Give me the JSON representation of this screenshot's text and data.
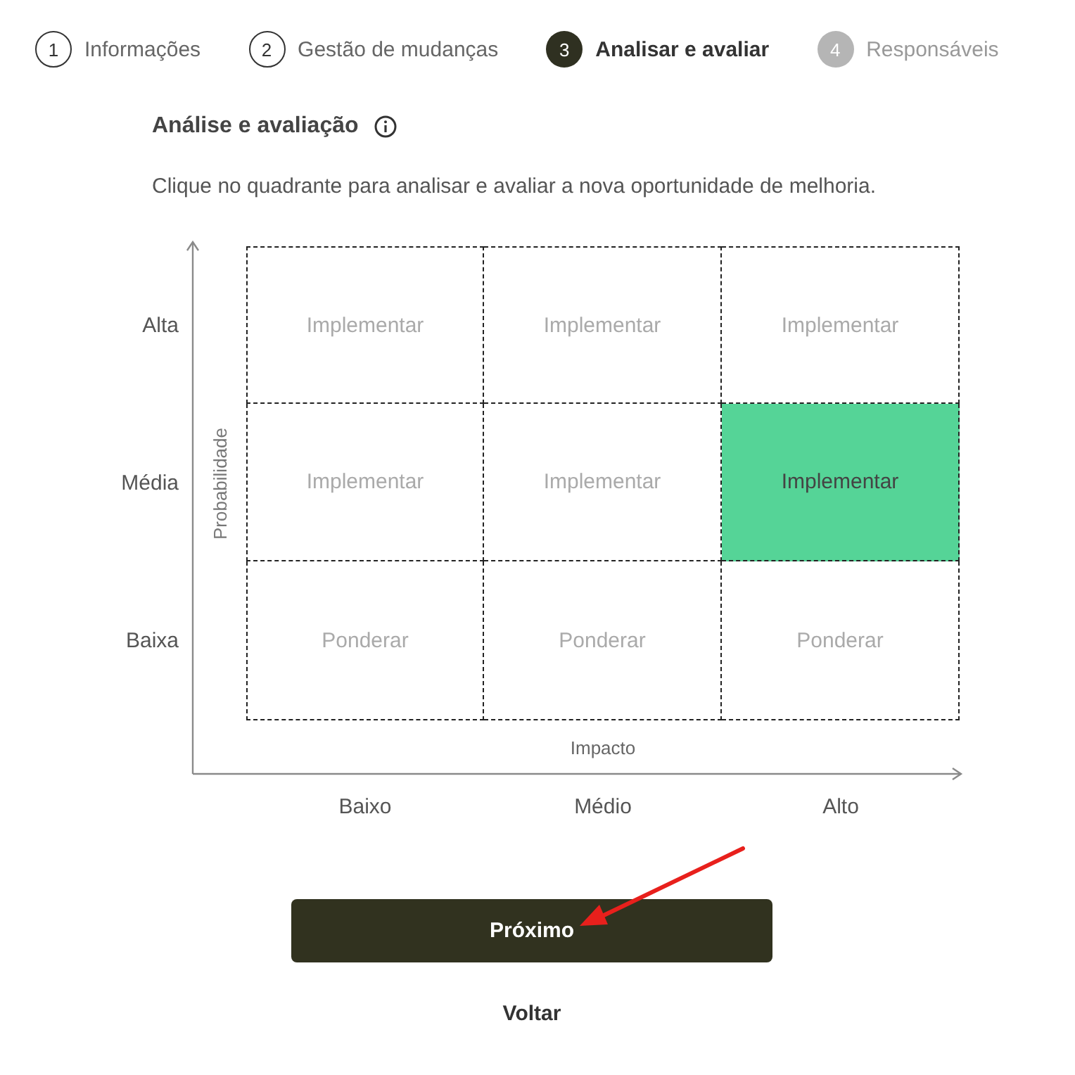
{
  "steps": [
    {
      "number": "1",
      "label": "Informações",
      "completed": true,
      "selected": false
    },
    {
      "number": "2",
      "label": "Gestão de mudanças",
      "completed": true,
      "selected": false
    },
    {
      "number": "3",
      "label": "Analisar e avaliar",
      "completed": false,
      "selected": true
    },
    {
      "number": "4",
      "label": "Responsáveis",
      "completed": false,
      "selected": false
    }
  ],
  "section": {
    "title": "Análise e avaliação",
    "description": "Clique no quadrante para analisar e avaliar a nova oportunidade de melhoria."
  },
  "matrix": {
    "y_axis_label": "Probabilidade",
    "rows": [
      {
        "label": "Alta",
        "cells": [
          {
            "text": "Implementar",
            "selected": false
          },
          {
            "text": "Implementar",
            "selected": false
          },
          {
            "text": "Implementar",
            "selected": false
          }
        ]
      },
      {
        "label": "Média",
        "cells": [
          {
            "text": "Implementar",
            "selected": false
          },
          {
            "text": "Implementar",
            "selected": false
          },
          {
            "text": "Implementar",
            "selected": true
          }
        ]
      },
      {
        "label": "Baixa",
        "cells": [
          {
            "text": "Ponderar",
            "selected": false
          },
          {
            "text": "Ponderar",
            "selected": false
          },
          {
            "text": "Ponderar",
            "selected": false
          }
        ]
      }
    ],
    "x_axis_label": "Impacto",
    "x_axis_levels": [
      "Baixo",
      "Médio",
      "Alto"
    ]
  },
  "buttons": {
    "next": "Próximo",
    "back": "Voltar"
  },
  "annotations": [
    {
      "kind": "arrow"
    }
  ]
}
